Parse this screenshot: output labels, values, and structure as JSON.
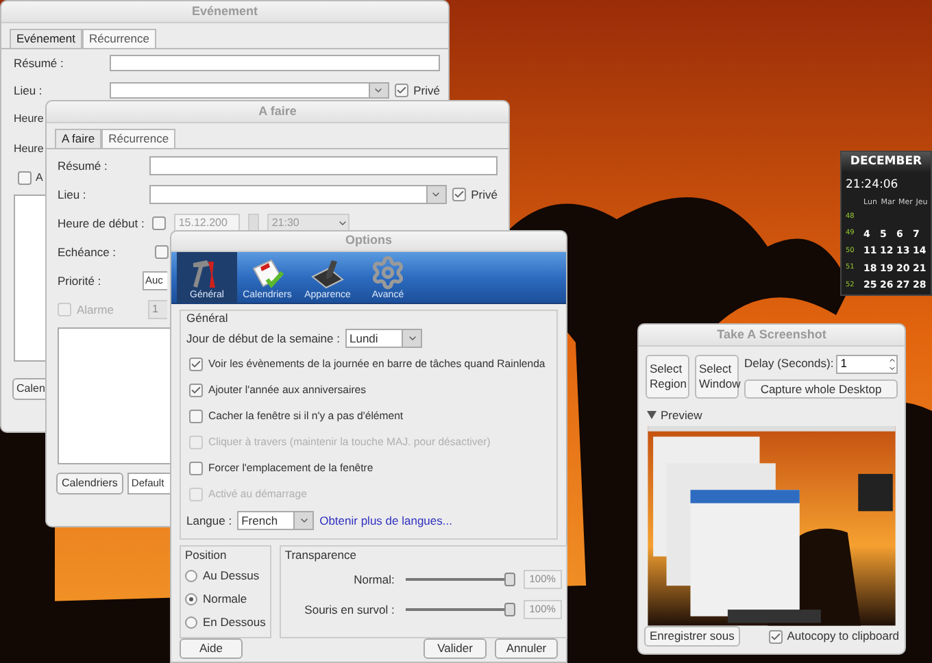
{
  "event_window": {
    "title": "Evénement",
    "tabs": [
      {
        "label": "Evénement",
        "selected": true
      },
      {
        "label": "Récurrence",
        "selected": false
      }
    ],
    "summary_label": "Résumé :",
    "location_label": "Lieu :",
    "private": {
      "label": "Privé",
      "checked": true
    },
    "row_labels": [
      "Heure",
      "Heure"
    ],
    "reminder": {
      "label": "A",
      "checked": false
    },
    "calendars_button": "Calen"
  },
  "todo_window": {
    "title": "A faire",
    "tabs": [
      {
        "label": "A faire",
        "selected": true
      },
      {
        "label": "Récurrence",
        "selected": false
      }
    ],
    "summary_label": "Résumé :",
    "location_label": "Lieu :",
    "private": {
      "label": "Privé",
      "checked": true
    },
    "start": {
      "label": "Heure de début :",
      "checked": false,
      "date": "15.12.200",
      "time": "21:30"
    },
    "due": {
      "label": "Echéance :",
      "checked": false
    },
    "priority": {
      "label": "Priorité :",
      "value": "Auc"
    },
    "alarm": {
      "label": "Alarme",
      "checked": false,
      "value": "1"
    },
    "calendars_button": "Calendriers",
    "calendar_select": "Default"
  },
  "options_window": {
    "title": "Options",
    "toolbar": [
      {
        "kind": "tools",
        "label": "Général",
        "selected": true
      },
      {
        "kind": "calendar",
        "label": "Calendriers",
        "selected": false
      },
      {
        "kind": "brush",
        "label": "Apparence",
        "selected": false
      },
      {
        "kind": "gear",
        "label": "Avancé",
        "selected": false
      }
    ],
    "general": {
      "title": "Général",
      "week_start": {
        "label": "Jour de début de la semaine :",
        "value": "Lundi"
      },
      "options": [
        {
          "label": "Voir les évènements de la journée en barre de tâches quand Rainlenda",
          "checked": true,
          "disabled": false
        },
        {
          "label": "Ajouter l'année aux anniversaires",
          "checked": true,
          "disabled": false
        },
        {
          "label": "Cacher la fenêtre si il n'y a pas d'élément",
          "checked": false,
          "disabled": false
        },
        {
          "label": "Cliquer à travers (maintenir la touche MAJ. pour désactiver)",
          "checked": false,
          "disabled": true
        },
        {
          "label": "Forcer l'emplacement de la fenêtre",
          "checked": false,
          "disabled": false
        },
        {
          "label": "Activé au démarrage",
          "checked": false,
          "disabled": true
        }
      ],
      "language": {
        "label": "Langue :",
        "value": "French",
        "link": "Obtenir plus de langues..."
      }
    },
    "position": {
      "title": "Position",
      "options": [
        {
          "label": "Au Dessus",
          "selected": false
        },
        {
          "label": "Normale",
          "selected": true
        },
        {
          "label": "En Dessous",
          "selected": false
        }
      ]
    },
    "transparency": {
      "title": "Transparence",
      "sliders": [
        {
          "label": "Normal:",
          "level": 1,
          "value": "100%"
        },
        {
          "label": "Souris en survol :",
          "level": 1,
          "value": "100%"
        }
      ]
    },
    "buttons": [
      "Aide",
      "Valider",
      "Annuler"
    ]
  },
  "calendar_widget": {
    "month": "DECEMBER",
    "time": "21:24:06",
    "weekdays": [
      "Lun",
      "Mar",
      "Mer",
      "Jeu"
    ],
    "weeks": [
      {
        "number": "48"
      },
      {
        "number": "49",
        "days": [
          "4",
          "5",
          "6",
          "7"
        ]
      },
      {
        "number": "50",
        "days": [
          "11",
          "12",
          "13",
          "14"
        ]
      },
      {
        "number": "51",
        "days": [
          "18",
          "19",
          "20",
          "21"
        ]
      },
      {
        "number": "52",
        "days": [
          "25",
          "26",
          "27",
          "28"
        ]
      }
    ]
  },
  "screenshot_window": {
    "title": "Take A Screenshot",
    "buttons": [
      "Select Region",
      "Select Window"
    ],
    "delay": {
      "label": "Delay (Seconds):",
      "value": "1"
    },
    "capture_button": "Capture whole Desktop",
    "preview": {
      "label": "Preview",
      "expanded": true
    },
    "save_button": "Enregistrer sous",
    "autocopy": {
      "label": "Autocopy to clipboard",
      "checked": true
    }
  }
}
